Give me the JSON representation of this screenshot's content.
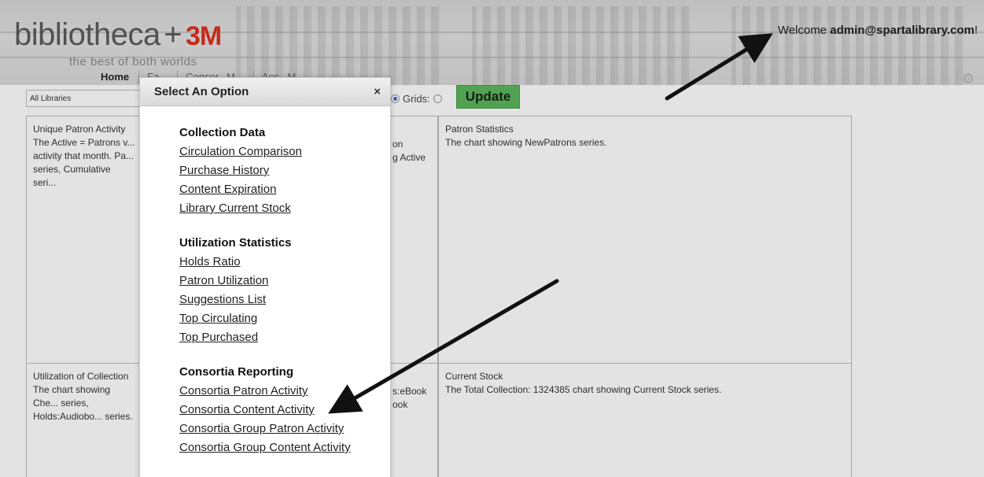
{
  "header": {
    "logo_main": "bibliotheca",
    "logo_plus": "+",
    "logo_brand": "3M",
    "tagline": "the best of both worlds",
    "nav": [
      "Home",
      "Fa...",
      "Consor...M...",
      "Acc...M..."
    ],
    "welcome_prefix": "Welcome ",
    "welcome_user": "admin@spartalibrary.com",
    "welcome_suffix": "!"
  },
  "filters": {
    "library": "All Libraries",
    "grids_label": "Grids:",
    "update_label": "Update"
  },
  "panels": {
    "p1_title": "Unique Patron Activity",
    "p1_desc": "The Active = Patrons v... activity that month. Pa... series, Cumulative seri...",
    "p1_right": "on",
    "p1_right2": "g Active",
    "p2_title": "Patron Statistics",
    "p2_desc": "The chart showing NewPatrons series.",
    "p3_title": "Utilization of Collection",
    "p3_desc": "The chart showing Che... series, Holds:Audiobo... series.",
    "p3_right": "s:eBook",
    "p3_right2": "ook",
    "p4_title": "Current Stock",
    "p4_desc": "The Total Collection: 1324385 chart showing Current Stock series."
  },
  "modal": {
    "title": "Select An Option",
    "close": "×",
    "sections": [
      {
        "title": "Collection Data",
        "links": [
          "Circulation Comparison",
          "Purchase History",
          "Content Expiration",
          "Library Current Stock"
        ]
      },
      {
        "title": "Utilization Statistics",
        "links": [
          "Holds Ratio",
          "Patron Utilization",
          "Suggestions List",
          "Top Circulating",
          "Top Purchased"
        ]
      },
      {
        "title": "Consortia Reporting",
        "links": [
          "Consortia Patron Activity",
          "Consortia Content Activity",
          "Consortia Group Patron Activity",
          "Consortia Group Content Activity"
        ]
      }
    ]
  },
  "colors": {
    "update_bg": "#5cb85c",
    "brand_red": "#e0301e",
    "arrow": "#111111"
  },
  "icons": {
    "gear": "gear-icon",
    "close": "close-icon"
  }
}
